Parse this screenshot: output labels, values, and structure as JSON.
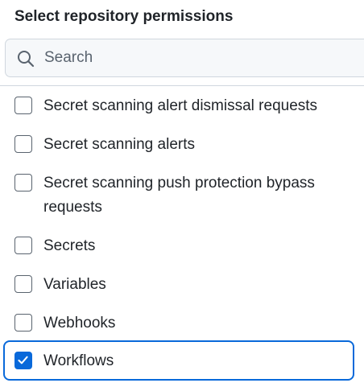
{
  "header": {
    "title": "Select repository permissions"
  },
  "search": {
    "placeholder": "Search",
    "value": "",
    "icon": "search-icon"
  },
  "permissions": {
    "items": [
      {
        "label": "Secret scanning alert dismissal requests",
        "checked": false
      },
      {
        "label": "Secret scanning alerts",
        "checked": false
      },
      {
        "label": "Secret scanning push protection bypass requests",
        "checked": false
      },
      {
        "label": "Secrets",
        "checked": false
      },
      {
        "label": "Variables",
        "checked": false
      },
      {
        "label": "Webhooks",
        "checked": false
      },
      {
        "label": "Workflows",
        "checked": true
      }
    ]
  },
  "colors": {
    "accent": "#0969da",
    "border": "#d0d7de",
    "text": "#1f2328",
    "muted": "#59636e"
  }
}
